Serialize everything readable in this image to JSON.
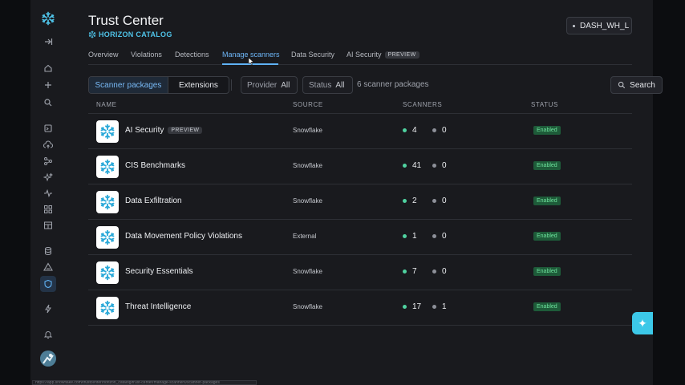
{
  "page": {
    "title": "Trust Center",
    "subtitle": "HORIZON CATALOG",
    "warehouse": "DASH_WH_L"
  },
  "tabs": [
    {
      "label": "Overview"
    },
    {
      "label": "Violations"
    },
    {
      "label": "Detections"
    },
    {
      "label": "Manage scanners",
      "active": true
    },
    {
      "label": "Data Security"
    },
    {
      "label": "AI Security",
      "badge": "PREVIEW"
    }
  ],
  "toolbar": {
    "segment": [
      "Scanner packages",
      "Extensions"
    ],
    "provider_label": "Provider",
    "provider_value": "All",
    "status_label": "Status",
    "status_value": "All",
    "count_text": "6 scanner packages",
    "search_label": "Search"
  },
  "table": {
    "columns": [
      "NAME",
      "SOURCE",
      "SCANNERS",
      "STATUS"
    ],
    "rows": [
      {
        "name": "AI Security",
        "badge": "PREVIEW",
        "source": "Snowflake",
        "active": "4",
        "inactive": "0",
        "status": "Enabled"
      },
      {
        "name": "CIS Benchmarks",
        "source": "Snowflake",
        "active": "41",
        "inactive": "0",
        "status": "Enabled"
      },
      {
        "name": "Data Exfiltration",
        "source": "Snowflake",
        "active": "2",
        "inactive": "0",
        "status": "Enabled"
      },
      {
        "name": "Data Movement Policy Violations",
        "source": "External",
        "active": "1",
        "inactive": "0",
        "status": "Enabled"
      },
      {
        "name": "Security Essentials",
        "source": "Snowflake",
        "active": "7",
        "inactive": "0",
        "status": "Enabled"
      },
      {
        "name": "Threat Intelligence",
        "source": "Snowflake",
        "active": "17",
        "inactive": "1",
        "status": "Enabled"
      }
    ]
  },
  "sidebar": {
    "icons": [
      "expand-icon",
      "home-icon",
      "plus-icon",
      "search-icon",
      "projects-icon",
      "upload-icon",
      "data-icon",
      "ai-icon",
      "monitoring-icon",
      "grid-icon",
      "marketplace-icon",
      "database-icon",
      "alert-icon",
      "shield-icon",
      "bolt-icon",
      "bell-icon"
    ]
  },
  "colors": {
    "accent": "#5fb2f5",
    "brand": "#4fc3e8",
    "enabled": "#6ee39d",
    "active_dot": "#4fd2a0"
  },
  "statusbar_text": "https://app.snowflake.com/trustcenter/horizon_catalog/trust-center/manage-scanners/scanner-packages"
}
